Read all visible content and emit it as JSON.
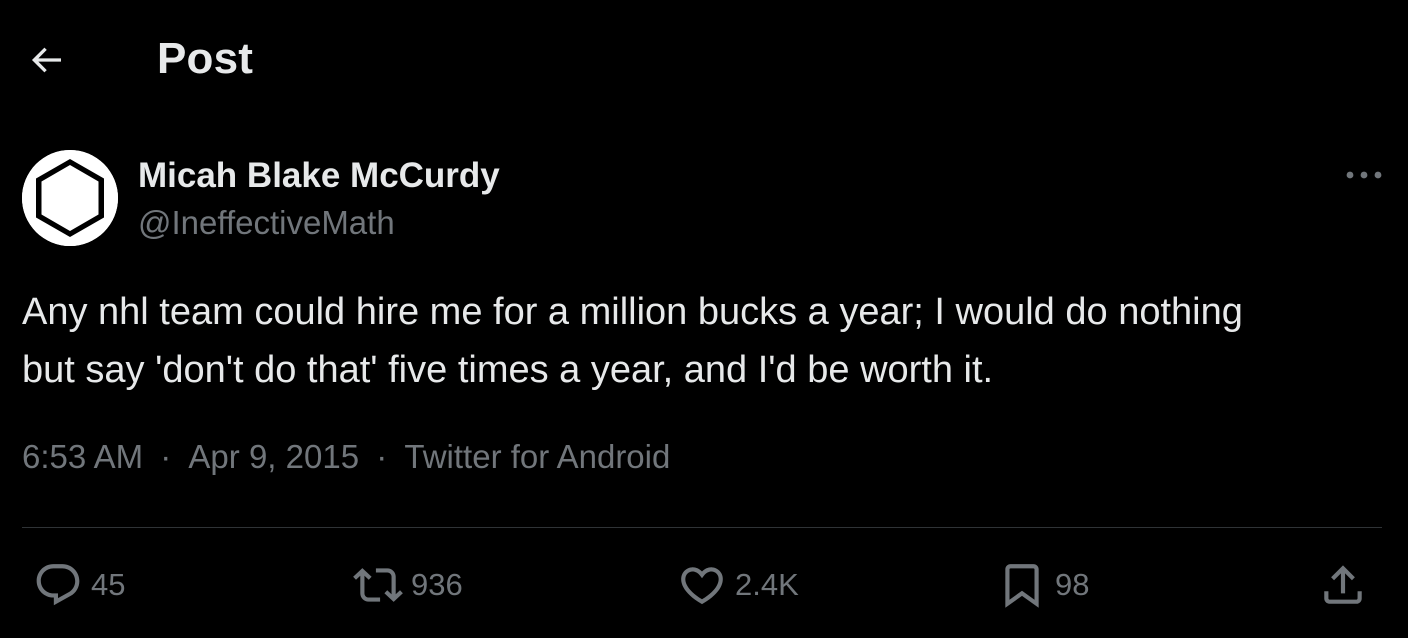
{
  "header": {
    "back_icon": "arrow-left-icon",
    "title": "Post"
  },
  "author": {
    "display_name": "Micah Blake McCurdy",
    "handle": "@IneffectiveMath",
    "avatar_icon": "hexagon-avatar",
    "more_icon": "more-horizontal-icon"
  },
  "tweet": {
    "text": "Any nhl team could hire me for a million bucks a year; I would do nothing\nbut say 'don't do that' five times a year, and I'd be worth it.",
    "time": "6:53 AM",
    "separator": "·",
    "date": "Apr 9, 2015",
    "source": "Twitter for Android"
  },
  "actions": {
    "reply": {
      "icon": "reply-icon",
      "count": "45"
    },
    "repost": {
      "icon": "repost-icon",
      "count": "936"
    },
    "like": {
      "icon": "heart-icon",
      "count": "2.4K"
    },
    "bookmark": {
      "icon": "bookmark-icon",
      "count": "98"
    },
    "share": {
      "icon": "share-icon"
    }
  },
  "colors": {
    "background": "#000000",
    "primary_text": "#e7e9ea",
    "secondary_text": "#71767b",
    "divider": "#2f3336"
  }
}
